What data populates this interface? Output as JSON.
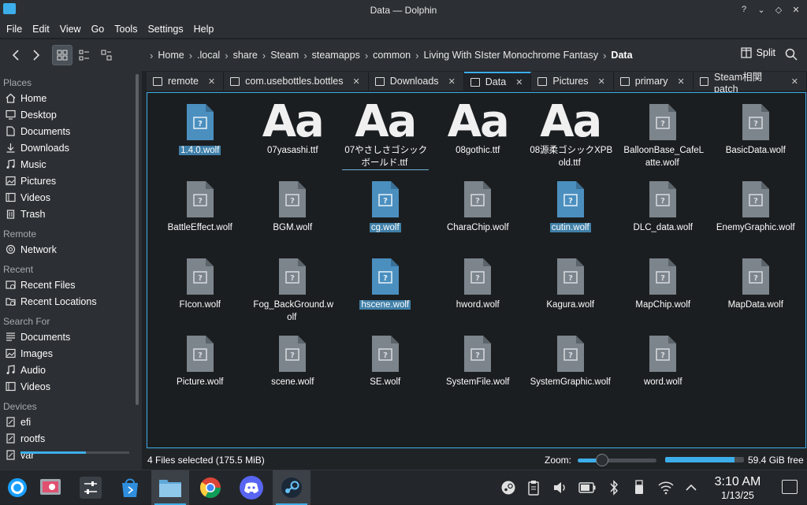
{
  "window": {
    "title": "Data — Dolphin"
  },
  "menubar": [
    "File",
    "Edit",
    "View",
    "Go",
    "Tools",
    "Settings",
    "Help"
  ],
  "breadcrumb": [
    "Home",
    ".local",
    "share",
    "Steam",
    "steamapps",
    "common",
    "Living With SIster Monochrome Fantasy",
    "Data"
  ],
  "toolbar": {
    "split_label": "Split"
  },
  "sidebar": {
    "places_header": "Places",
    "places": [
      "Home",
      "Desktop",
      "Documents",
      "Downloads",
      "Music",
      "Pictures",
      "Videos",
      "Trash"
    ],
    "remote_header": "Remote",
    "remote": [
      "Network"
    ],
    "recent_header": "Recent",
    "recent": [
      "Recent Files",
      "Recent Locations"
    ],
    "search_header": "Search For",
    "search": [
      "Documents",
      "Images",
      "Audio",
      "Videos"
    ],
    "devices_header": "Devices",
    "devices": [
      "efi",
      "rootfs",
      "var"
    ]
  },
  "tabs": [
    "remote",
    "com.usebottles.bottles",
    "Downloads",
    "Data",
    "Pictures",
    "primary",
    "Steam相関patch"
  ],
  "active_tab": "Data",
  "files": [
    {
      "name": "1.4.0.wolf",
      "type": "file",
      "selected": true
    },
    {
      "name": "07yasashi.ttf",
      "type": "font",
      "selected": false
    },
    {
      "name": "07やさしさゴシックボールド.ttf",
      "type": "font",
      "selected": false
    },
    {
      "name": "08gothic.ttf",
      "type": "font",
      "selected": false
    },
    {
      "name": "08源柔ゴシックXPBold.ttf",
      "type": "font",
      "selected": false
    },
    {
      "name": "BalloonBase_CafeLatte.wolf",
      "type": "file",
      "selected": false
    },
    {
      "name": "BasicData.wolf",
      "type": "file",
      "selected": false
    },
    {
      "name": "BattleEffect.wolf",
      "type": "file",
      "selected": false
    },
    {
      "name": "BGM.wolf",
      "type": "file",
      "selected": false
    },
    {
      "name": "cg.wolf",
      "type": "file",
      "selected": true
    },
    {
      "name": "CharaChip.wolf",
      "type": "file",
      "selected": false
    },
    {
      "name": "cutin.wolf",
      "type": "file",
      "selected": true
    },
    {
      "name": "DLC_data.wolf",
      "type": "file",
      "selected": false
    },
    {
      "name": "EnemyGraphic.wolf",
      "type": "file",
      "selected": false
    },
    {
      "name": "FIcon.wolf",
      "type": "file",
      "selected": false
    },
    {
      "name": "Fog_BackGround.wolf",
      "type": "file",
      "selected": false
    },
    {
      "name": "hscene.wolf",
      "type": "file",
      "selected": true
    },
    {
      "name": "hword.wolf",
      "type": "file",
      "selected": false
    },
    {
      "name": "Kagura.wolf",
      "type": "file",
      "selected": false
    },
    {
      "name": "MapChip.wolf",
      "type": "file",
      "selected": false
    },
    {
      "name": "MapData.wolf",
      "type": "file",
      "selected": false
    },
    {
      "name": "Picture.wolf",
      "type": "file",
      "selected": false
    },
    {
      "name": "scene.wolf",
      "type": "file",
      "selected": false
    },
    {
      "name": "SE.wolf",
      "type": "file",
      "selected": false
    },
    {
      "name": "SystemFile.wolf",
      "type": "file",
      "selected": false
    },
    {
      "name": "SystemGraphic.wolf",
      "type": "file",
      "selected": false
    },
    {
      "name": "word.wolf",
      "type": "file",
      "selected": false
    }
  ],
  "font_icon_text": "Aa",
  "statusbar": {
    "selection": "4 Files selected (175.5 MiB)",
    "zoom_label": "Zoom:",
    "free_space": "59.4 GiB free",
    "zoom_level": 0.3,
    "disk_used_fraction": 0.88
  },
  "taskbar": {
    "apps": [
      "app-launcher-icon",
      "screenshot-app-icon",
      "system-settings-icon",
      "discover-store-icon",
      "dolphin-icon",
      "chrome-icon",
      "discord-icon",
      "steam-icon"
    ],
    "time": "3:10 AM",
    "date": "1/13/25"
  },
  "colors": {
    "accent": "#3daee9",
    "selection": "#3f7fa8",
    "background": "#1b1e20"
  }
}
